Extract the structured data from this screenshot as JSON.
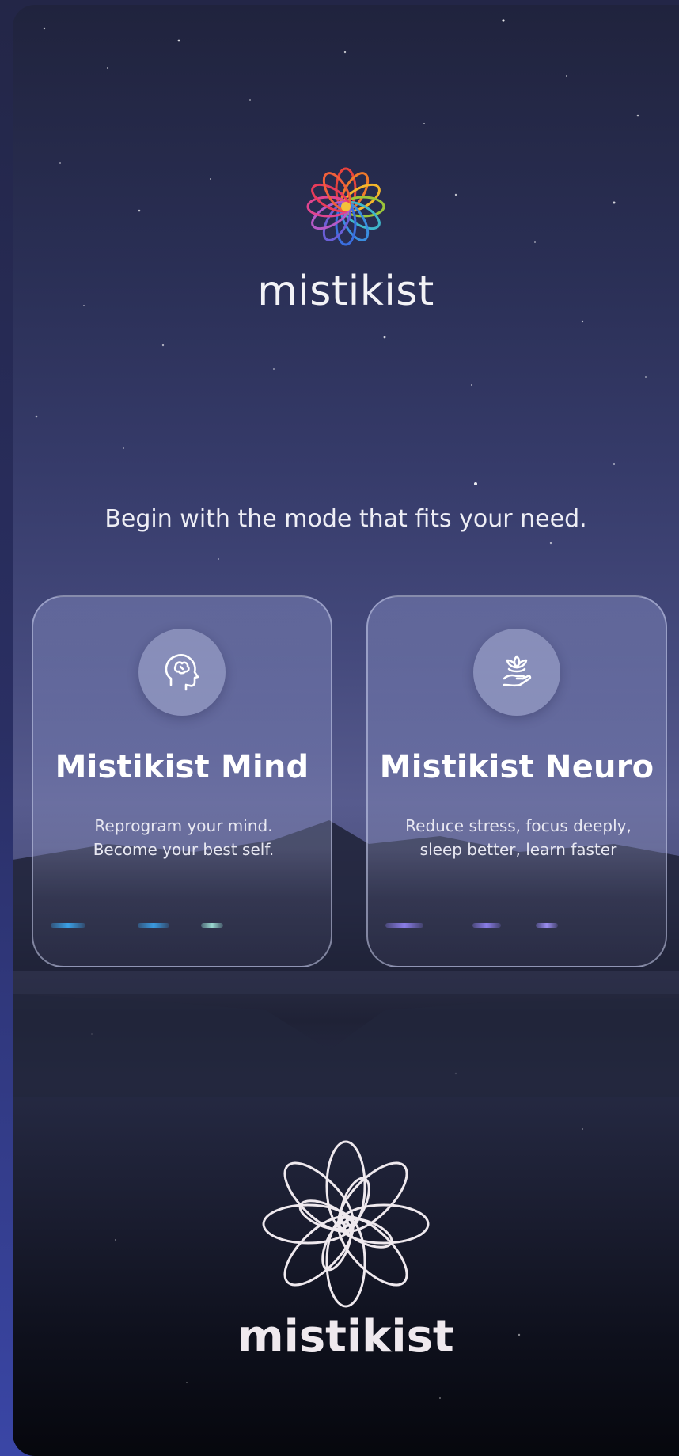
{
  "app": {
    "brand_top": "mistikist",
    "brand_bottom": "mistikist",
    "tagline": "Begin with the mode that fits your need."
  },
  "cards": [
    {
      "title": "Mistikist Mind",
      "desc_line1": "Reprogram your mind.",
      "desc_line2": "Become your best self.",
      "icon": "brain-head-icon",
      "accent": "#3aa0e6"
    },
    {
      "title": "Mistikist Neuro",
      "desc_line1": "Reduce stress, focus deeply,",
      "desc_line2": "sleep better, learn faster",
      "icon": "lotus-hand-icon",
      "accent": "#8a7de8"
    }
  ],
  "icons": {
    "top_logo": "mandala-color-logo-icon",
    "bottom_logo": "mandala-outline-logo-icon"
  }
}
